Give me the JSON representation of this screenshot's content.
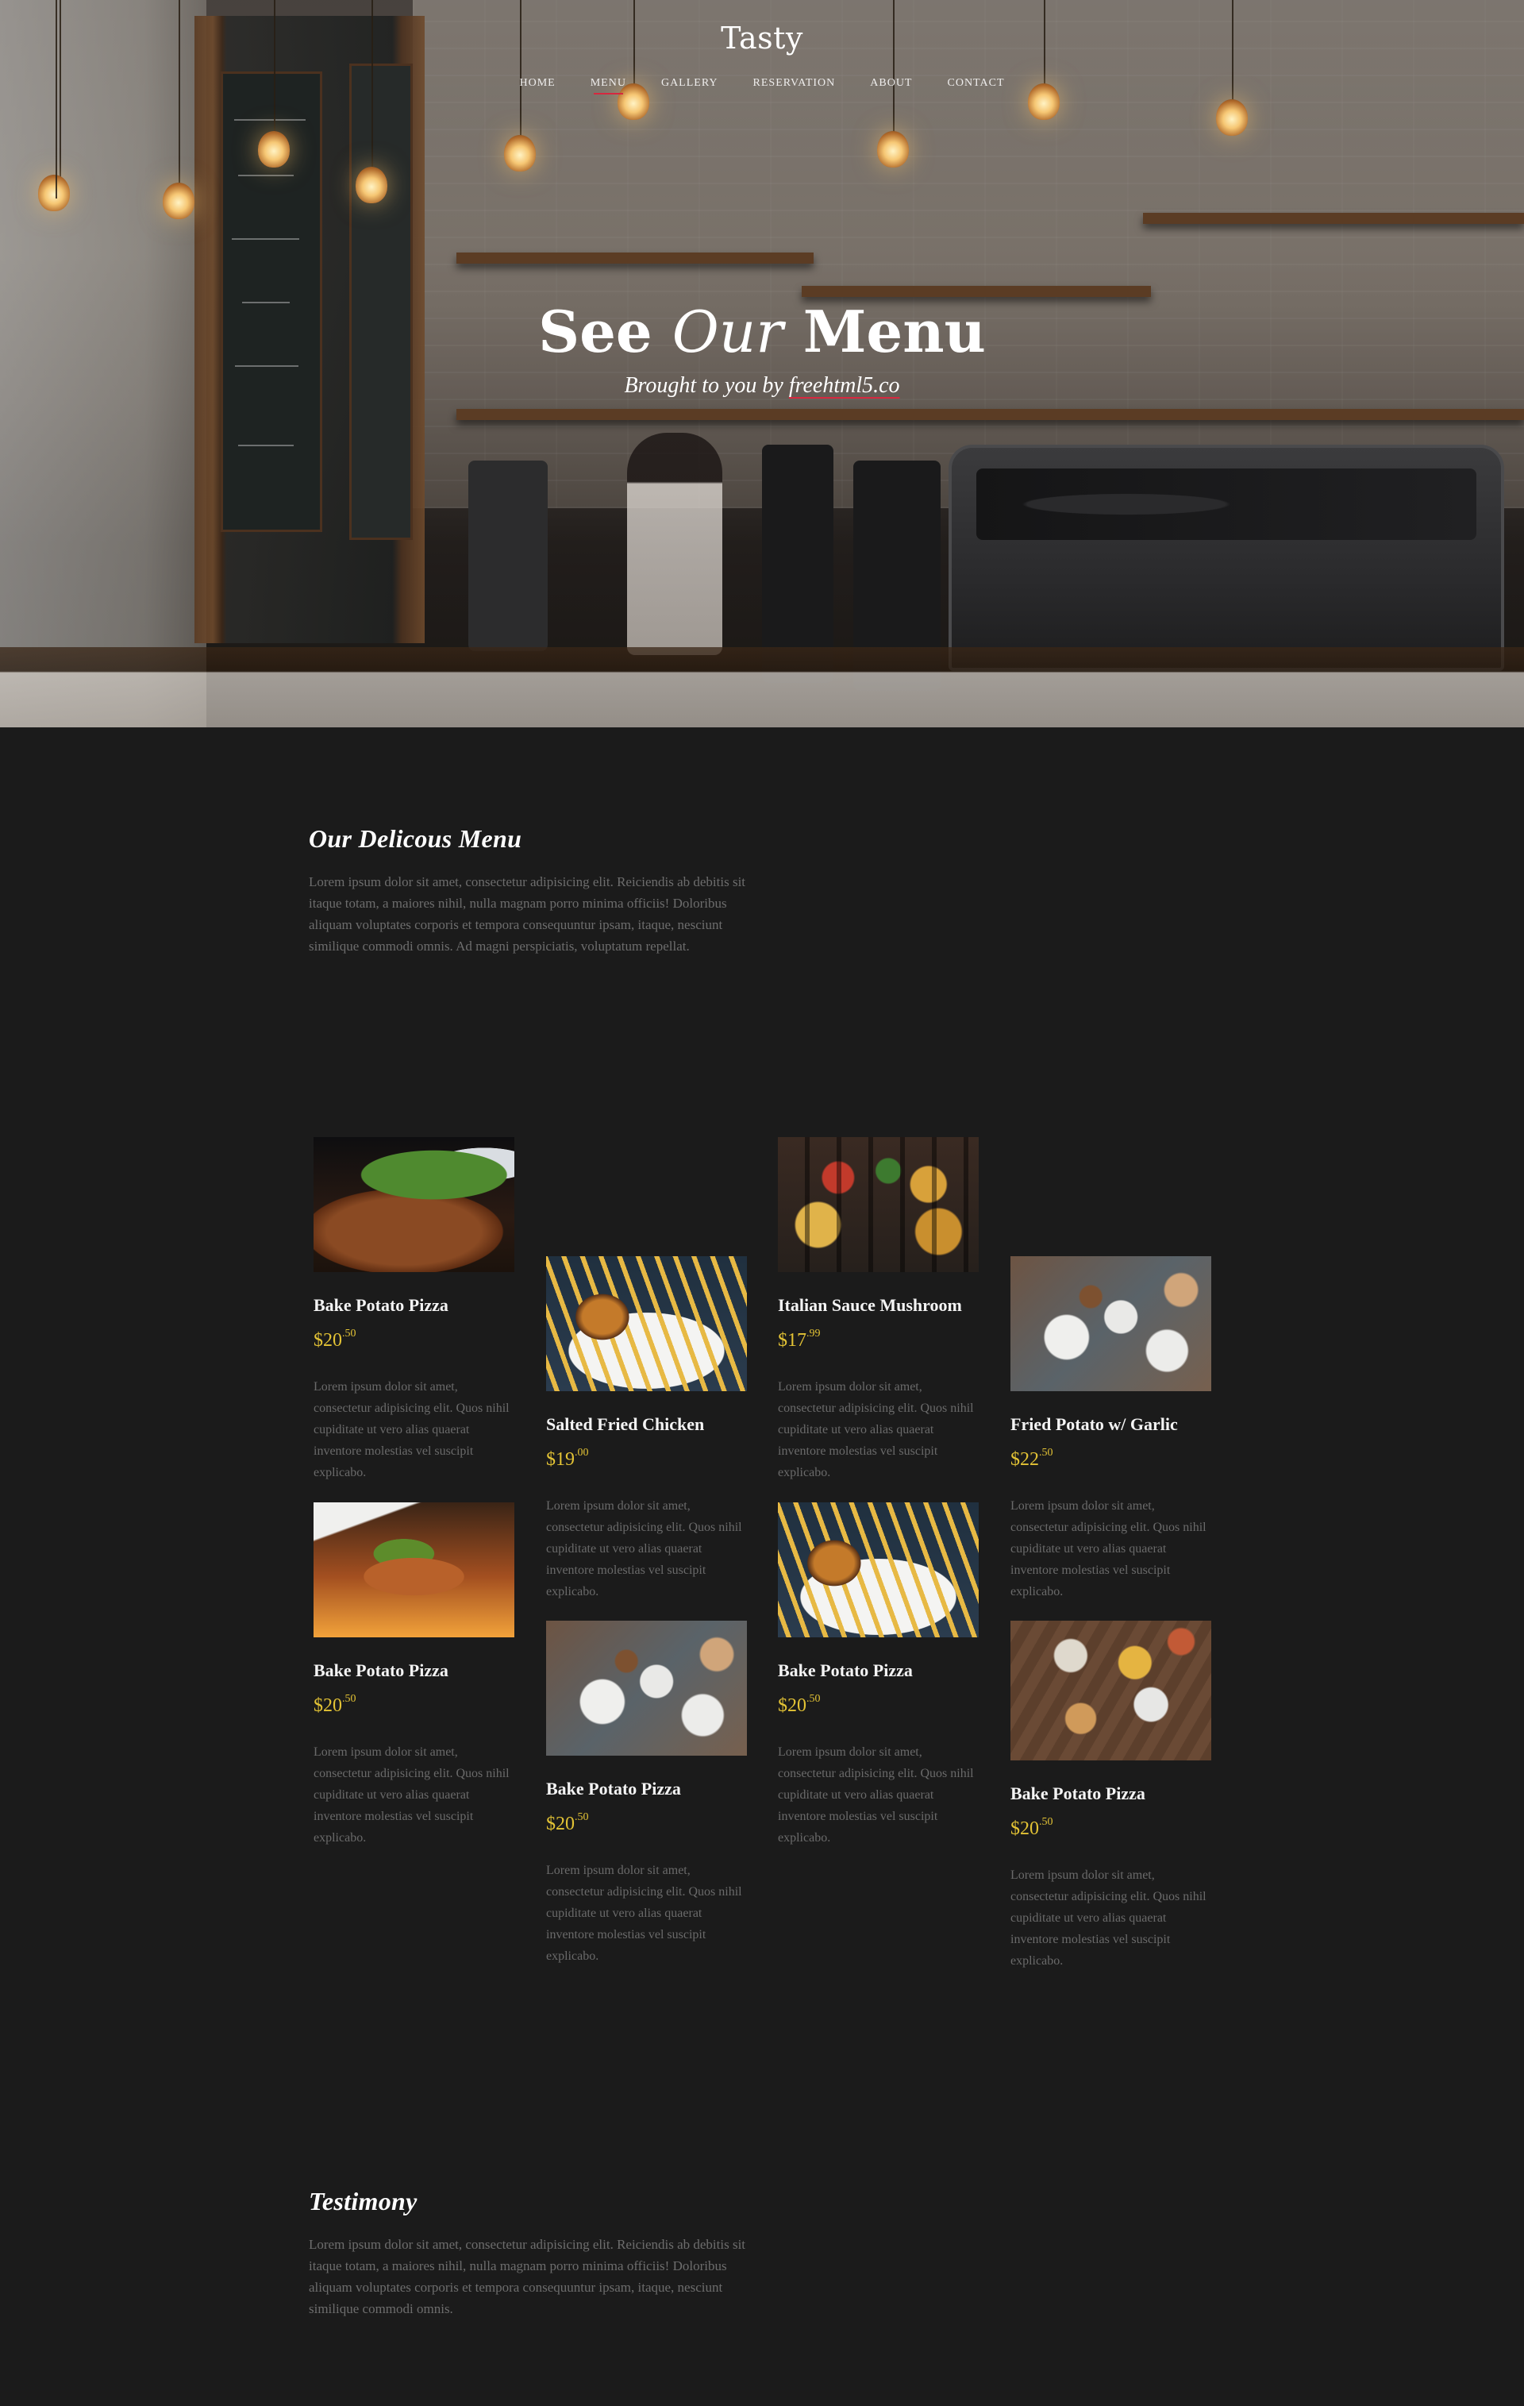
{
  "brand": "Tasty",
  "nav": {
    "items": [
      "HOME",
      "MENU",
      "GALLERY",
      "RESERVATION",
      "ABOUT",
      "CONTACT"
    ],
    "active": "MENU"
  },
  "hero": {
    "title_part1": "See",
    "title_em": "Our",
    "title_part2": "Menu",
    "subtitle_prefix": "Brought to you by",
    "subtitle_link": "freehtml5.co"
  },
  "menu_section": {
    "title": "Our Delicous Menu",
    "text": "Lorem ipsum dolor sit amet, consectetur adipisicing elit. Reiciendis ab debitis sit itaque totam, a maiores nihil, nulla magnam porro minima officiis! Doloribus aliquam voluptates corporis et tempora consequuntur ipsam, itaque, nesciunt similique commodi omnis. Ad magni perspiciatis, voluptatum repellat."
  },
  "menu_items": [
    {
      "name": "Bake Potato Pizza",
      "price_main": "$20",
      "price_cents": ".50",
      "desc": "Lorem ipsum dolor sit amet, consectetur adipisicing elit. Quos nihil cupiditate ut vero alias quaerat inventore molestias vel suscipit explicabo.",
      "photo": "ribs-photo"
    },
    {
      "name": "Salted Fried Chicken",
      "price_main": "$19",
      "price_cents": ".00",
      "desc": "Lorem ipsum dolor sit amet, consectetur adipisicing elit. Quos nihil cupiditate ut vero alias quaerat inventore molestias vel suscipit explicabo.",
      "photo": "burger-photo"
    },
    {
      "name": "Italian Sauce Mushroom",
      "price_main": "$17",
      "price_cents": ".99",
      "desc": "Lorem ipsum dolor sit amet, consectetur adipisicing elit. Quos nihil cupiditate ut vero alias quaerat inventore molestias vel suscipit explicabo.",
      "photo": "kebab-photo"
    },
    {
      "name": "Fried Potato w/ Garlic",
      "price_main": "$22",
      "price_cents": ".50",
      "desc": "Lorem ipsum dolor sit amet, consectetur adipisicing elit. Quos nihil cupiditate ut vero alias quaerat inventore molestias vel suscipit explicabo.",
      "photo": "table-photo"
    },
    {
      "name": "Bake Potato Pizza",
      "price_main": "$20",
      "price_cents": ".50",
      "desc": "Lorem ipsum dolor sit amet, consectetur adipisicing elit. Quos nihil cupiditate ut vero alias quaerat inventore molestias vel suscipit explicabo.",
      "photo": "platter-photo"
    },
    {
      "name": "Bake Potato Pizza",
      "price_main": "$20",
      "price_cents": ".50",
      "desc": "Lorem ipsum dolor sit amet, consectetur adipisicing elit. Quos nihil cupiditate ut vero alias quaerat inventore molestias vel suscipit explicabo.",
      "photo": "table-photo"
    },
    {
      "name": "Bake Potato Pizza",
      "price_main": "$20",
      "price_cents": ".50",
      "desc": "Lorem ipsum dolor sit amet, consectetur adipisicing elit. Quos nihil cupiditate ut vero alias quaerat inventore molestias vel suscipit explicabo.",
      "photo": "burger-photo"
    },
    {
      "name": "Bake Potato Pizza",
      "price_main": "$20",
      "price_cents": ".50",
      "desc": "Lorem ipsum dolor sit amet, consectetur adipisicing elit. Quos nihil cupiditate ut vero alias quaerat inventore molestias vel suscipit explicabo.",
      "photo": "spread-photo"
    }
  ],
  "testimony_section": {
    "title": "Testimony",
    "text": "Lorem ipsum dolor sit amet, consectetur adipisicing elit. Reiciendis ab debitis sit itaque totam, a maiores nihil, nulla magnam porro minima officiis! Doloribus aliquam voluptates corporis et tempora consequuntur ipsam, itaque, nesciunt similique commodi omnis."
  },
  "colors": {
    "accent_red": "#d6283f",
    "price_gold": "#e3c335",
    "background": "#1b1b1b"
  }
}
